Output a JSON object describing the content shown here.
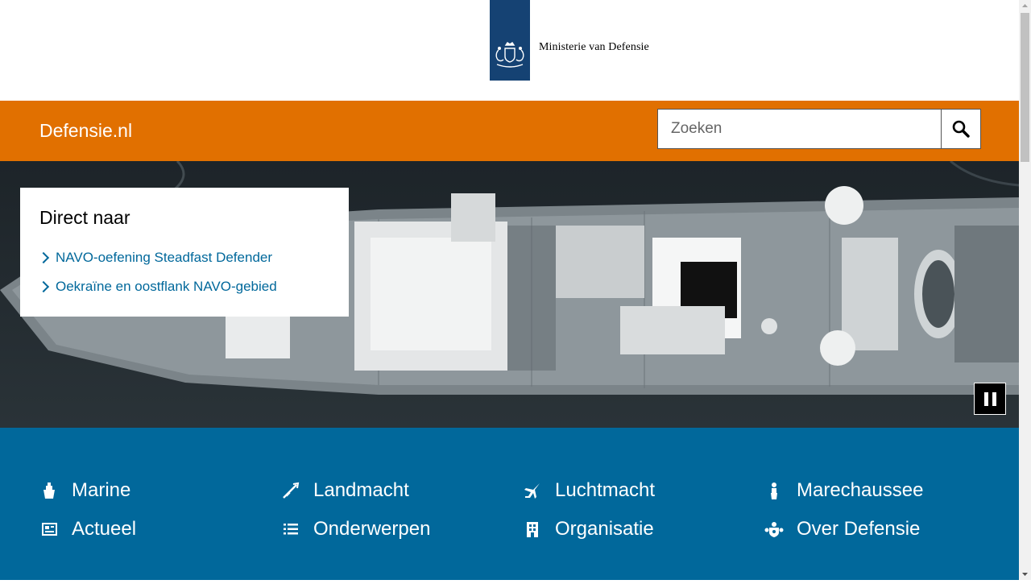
{
  "header": {
    "logo_text": "Ministerie van Defensie",
    "logo_icon": "coat-of-arms-icon",
    "ribbon_color": "#154273"
  },
  "bar": {
    "brand": "Defensie.nl",
    "color": "#e17000",
    "search": {
      "placeholder": "Zoeken",
      "value": "",
      "button_icon": "search-icon"
    }
  },
  "hero": {
    "image": "navy-ship-aerial-photo",
    "direct": {
      "title": "Direct naar",
      "links": [
        "NAVO-oefening Steadfast Defender",
        "Oekraïne en oostflank NAVO-gebied"
      ]
    },
    "pause_icon": "pause-icon"
  },
  "nav": {
    "color": "#01689b",
    "items": [
      {
        "label": "Marine",
        "icon": "marine-icon"
      },
      {
        "label": "Landmacht",
        "icon": "landmacht-icon"
      },
      {
        "label": "Luchtmacht",
        "icon": "luchtmacht-icon"
      },
      {
        "label": "Marechaussee",
        "icon": "marechaussee-icon"
      },
      {
        "label": "Actueel",
        "icon": "newspaper-icon"
      },
      {
        "label": "Onderwerpen",
        "icon": "list-icon"
      },
      {
        "label": "Organisatie",
        "icon": "building-icon"
      },
      {
        "label": "Over Defensie",
        "icon": "emblem-icon"
      }
    ]
  }
}
